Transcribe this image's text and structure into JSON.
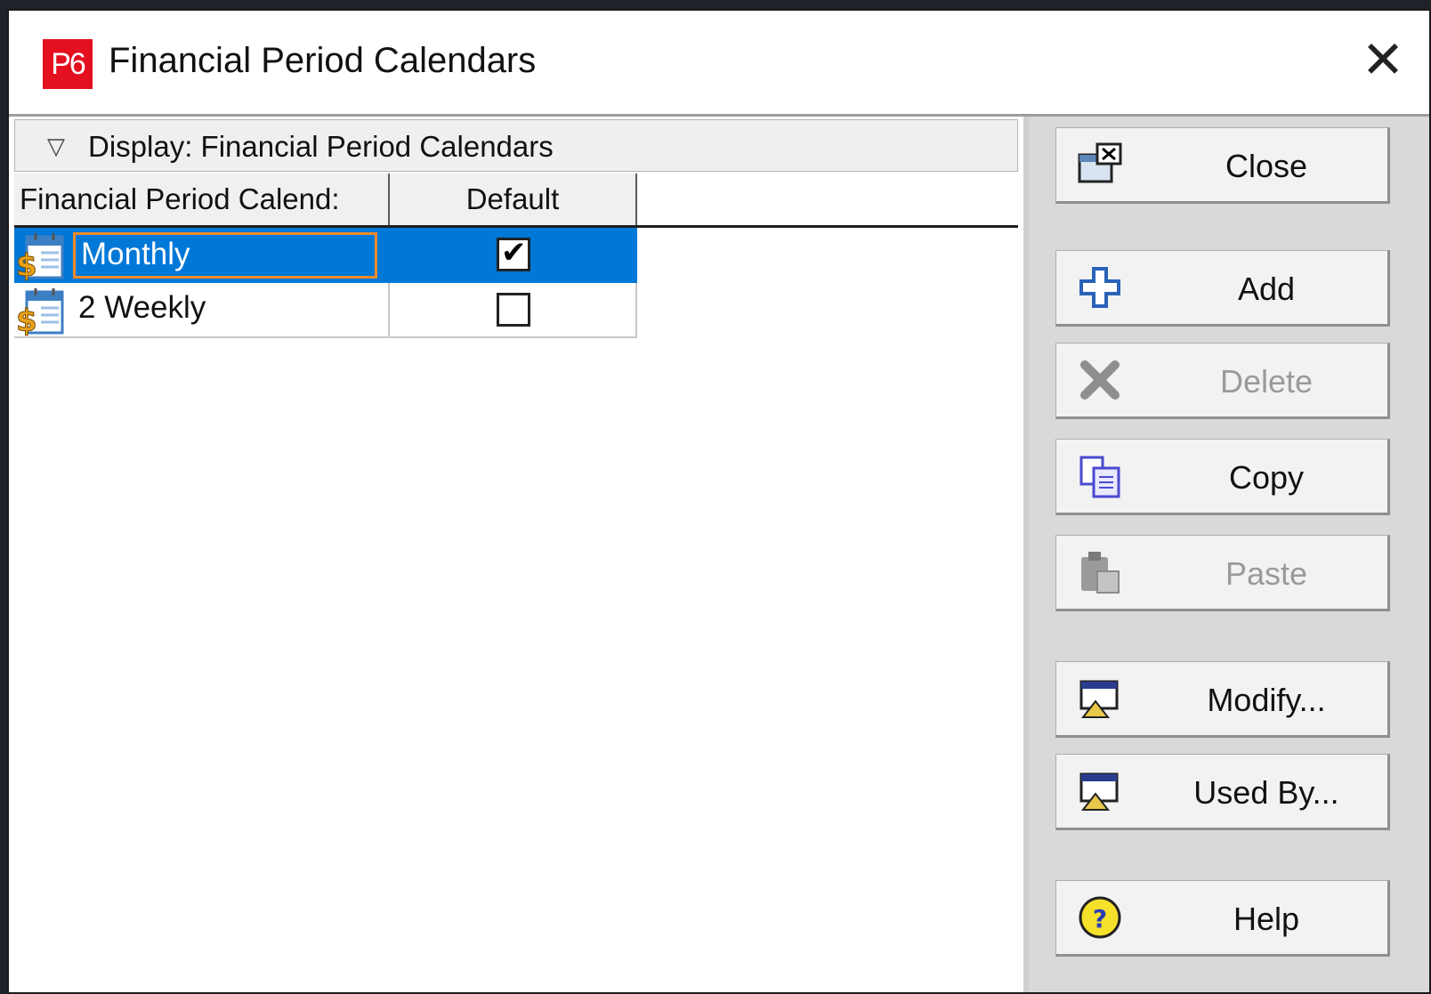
{
  "window": {
    "title": "Financial Period Calendars",
    "app_icon_text": "P6",
    "close_glyph": "✕"
  },
  "display_bar": {
    "label": "Display: Financial Period Calendars",
    "arrow_glyph": "▽"
  },
  "table": {
    "columns": [
      "Financial Period Calend:",
      "Default"
    ],
    "rows": [
      {
        "name": "Monthly",
        "default": true,
        "selected": true,
        "icon": "financial-calendar-icon"
      },
      {
        "name": "2 Weekly",
        "default": false,
        "selected": false,
        "icon": "financial-calendar-icon"
      }
    ]
  },
  "buttons": {
    "close": {
      "label": "Close",
      "icon": "close-window-icon",
      "enabled": true
    },
    "add": {
      "label": "Add",
      "icon": "plus-icon",
      "enabled": true
    },
    "delete": {
      "label": "Delete",
      "icon": "delete-x-icon",
      "enabled": false
    },
    "copy": {
      "label": "Copy",
      "icon": "copy-icon",
      "enabled": true
    },
    "paste": {
      "label": "Paste",
      "icon": "paste-icon",
      "enabled": false
    },
    "modify": {
      "label": "Modify...",
      "icon": "modify-icon",
      "enabled": true
    },
    "used_by": {
      "label": "Used By...",
      "icon": "used-by-icon",
      "enabled": true
    },
    "help": {
      "label": "Help",
      "icon": "help-icon",
      "enabled": true
    }
  },
  "colors": {
    "selection": "#0078d7",
    "focus_border": "#f08a2a",
    "app_icon": "#e3101f"
  }
}
